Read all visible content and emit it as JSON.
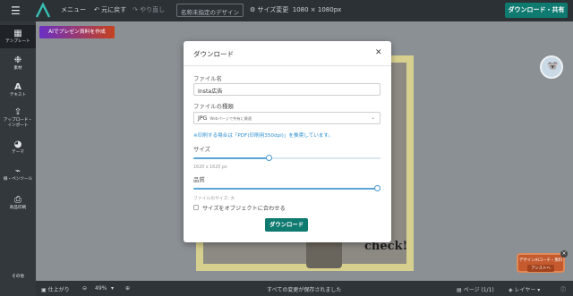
{
  "topbar": {
    "menu_label": "メニュー",
    "undo_label": "元に戻す",
    "redo_label": "やり直し",
    "design_name_placeholder": "名称未指定のデザイン",
    "resize_label": "サイズ変更",
    "size_value": "1080 × 1080px",
    "download_share_label": "ダウンロード・共有"
  },
  "sidebar": {
    "items": [
      {
        "label": "テンプレート",
        "icon": "template-icon"
      },
      {
        "label": "素材",
        "icon": "asset-icon"
      },
      {
        "label": "テキスト",
        "icon": "text-icon"
      },
      {
        "label": "アップロード・インポート",
        "icon": "upload-icon"
      },
      {
        "label": "テーマ",
        "icon": "palette-icon"
      },
      {
        "label": "線・ペンツール",
        "icon": "pen-tool-icon"
      },
      {
        "label": "商品印刷",
        "icon": "printer-icon"
      }
    ],
    "bottom_label": "その他"
  },
  "workspace": {
    "ai_button_label": "AIでプレゼン資料を作成",
    "canvas_text": "check!",
    "promo_title": "デザインAIコーチ・無料",
    "promo_button": "アシストへ"
  },
  "bottombar": {
    "finish_label": "仕上がり",
    "zoom_value": "49%",
    "save_status": "すべての変更が保存されました",
    "page_label": "ページ",
    "page_count": "(1/1)",
    "layer_label": "レイヤー"
  },
  "modal": {
    "title": "ダウンロード",
    "filename_label": "ファイル名",
    "filename_value": "Insta広告",
    "filetype_label": "ファイルの種類",
    "filetype_value": "JPG",
    "filetype_hint": "Webページで共有に最適",
    "print_note": "※印刷する場合は「PDF(印刷用350dpi)」を推奨しています。",
    "size_label": "サイズ",
    "size_slider": 0.4,
    "size_value": "1620 x 1620 px",
    "quality_label": "品質",
    "quality_slider": 1.0,
    "filesize_label": "ファイルのサイズ: 大",
    "fit_checkbox_label": "サイズをオブジェクトに合わせる",
    "fit_checkbox_checked": false,
    "download_button": "ダウンロード"
  },
  "colors": {
    "accent": "#0f7a70",
    "link": "#2d8fd1",
    "slider": "#5aa4d6"
  }
}
